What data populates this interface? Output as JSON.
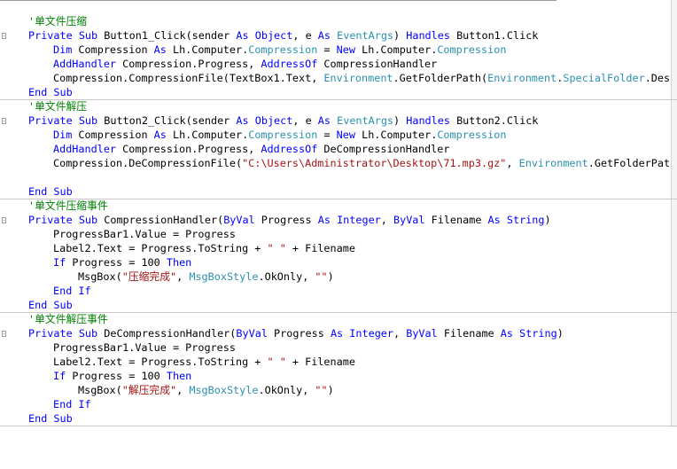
{
  "colors": {
    "keyword": "#0000ff",
    "type": "#2b91af",
    "comment": "#008000",
    "string": "#a31515",
    "plain": "#000000"
  },
  "code": {
    "lines": [
      {
        "indent": 0,
        "tokens": [
          {
            "t": "'单文件压缩",
            "k": "comment"
          }
        ]
      },
      {
        "indent": 0,
        "tokens": [
          {
            "t": "Private Sub",
            "k": "keyword"
          },
          {
            "t": " Button1_Click(sender ",
            "k": "plain"
          },
          {
            "t": "As",
            "k": "keyword"
          },
          {
            "t": " ",
            "k": "plain"
          },
          {
            "t": "Object",
            "k": "keyword"
          },
          {
            "t": ", e ",
            "k": "plain"
          },
          {
            "t": "As",
            "k": "keyword"
          },
          {
            "t": " ",
            "k": "plain"
          },
          {
            "t": "EventArgs",
            "k": "type"
          },
          {
            "t": ") ",
            "k": "plain"
          },
          {
            "t": "Handles",
            "k": "keyword"
          },
          {
            "t": " Button1.Click",
            "k": "plain"
          }
        ]
      },
      {
        "indent": 1,
        "tokens": [
          {
            "t": "Dim",
            "k": "keyword"
          },
          {
            "t": " Compression ",
            "k": "plain"
          },
          {
            "t": "As",
            "k": "keyword"
          },
          {
            "t": " Lh.Computer.",
            "k": "plain"
          },
          {
            "t": "Compression",
            "k": "type"
          },
          {
            "t": " = ",
            "k": "plain"
          },
          {
            "t": "New",
            "k": "keyword"
          },
          {
            "t": " Lh.Computer.",
            "k": "plain"
          },
          {
            "t": "Compression",
            "k": "type"
          }
        ]
      },
      {
        "indent": 1,
        "tokens": [
          {
            "t": "AddHandler",
            "k": "keyword"
          },
          {
            "t": " Compression.Progress, ",
            "k": "plain"
          },
          {
            "t": "AddressOf",
            "k": "keyword"
          },
          {
            "t": " CompressionHandler",
            "k": "plain"
          }
        ]
      },
      {
        "indent": 1,
        "tokens": [
          {
            "t": "Compression.CompressionFile(TextBox1.Text, ",
            "k": "plain"
          },
          {
            "t": "Environment",
            "k": "type"
          },
          {
            "t": ".GetFolderPath(",
            "k": "plain"
          },
          {
            "t": "Environment",
            "k": "type"
          },
          {
            "t": ".",
            "k": "plain"
          },
          {
            "t": "SpecialFolder",
            "k": "type"
          },
          {
            "t": ".Desktop",
            "k": "plain"
          }
        ]
      },
      {
        "indent": 0,
        "tokens": [
          {
            "t": "End Sub",
            "k": "keyword"
          }
        ]
      },
      {
        "indent": 0,
        "tokens": [
          {
            "t": "'单文件解压",
            "k": "comment"
          }
        ]
      },
      {
        "indent": 0,
        "tokens": [
          {
            "t": "Private Sub",
            "k": "keyword"
          },
          {
            "t": " Button2_Click(sender ",
            "k": "plain"
          },
          {
            "t": "As",
            "k": "keyword"
          },
          {
            "t": " ",
            "k": "plain"
          },
          {
            "t": "Object",
            "k": "keyword"
          },
          {
            "t": ", e ",
            "k": "plain"
          },
          {
            "t": "As",
            "k": "keyword"
          },
          {
            "t": " ",
            "k": "plain"
          },
          {
            "t": "EventArgs",
            "k": "type"
          },
          {
            "t": ") ",
            "k": "plain"
          },
          {
            "t": "Handles",
            "k": "keyword"
          },
          {
            "t": " Button2.Click",
            "k": "plain"
          }
        ]
      },
      {
        "indent": 1,
        "tokens": [
          {
            "t": "Dim",
            "k": "keyword"
          },
          {
            "t": " Compression ",
            "k": "plain"
          },
          {
            "t": "As",
            "k": "keyword"
          },
          {
            "t": " Lh.Computer.",
            "k": "plain"
          },
          {
            "t": "Compression",
            "k": "type"
          },
          {
            "t": " = ",
            "k": "plain"
          },
          {
            "t": "New",
            "k": "keyword"
          },
          {
            "t": " Lh.Computer.",
            "k": "plain"
          },
          {
            "t": "Compression",
            "k": "type"
          }
        ]
      },
      {
        "indent": 1,
        "tokens": [
          {
            "t": "AddHandler",
            "k": "keyword"
          },
          {
            "t": " Compression.Progress, ",
            "k": "plain"
          },
          {
            "t": "AddressOf",
            "k": "keyword"
          },
          {
            "t": " DeCompressionHandler",
            "k": "plain"
          }
        ]
      },
      {
        "indent": 1,
        "tokens": [
          {
            "t": "Compression.DeCompressionFile(",
            "k": "plain"
          },
          {
            "t": "\"C:\\Users\\Administrator\\Desktop\\71.mp3.gz\"",
            "k": "string"
          },
          {
            "t": ", ",
            "k": "plain"
          },
          {
            "t": "Environment",
            "k": "type"
          },
          {
            "t": ".GetFolderPath(E",
            "k": "plain"
          }
        ]
      },
      {
        "indent": 0,
        "tokens": []
      },
      {
        "indent": 0,
        "tokens": [
          {
            "t": "End Sub",
            "k": "keyword"
          }
        ]
      },
      {
        "indent": 0,
        "tokens": [
          {
            "t": "'单文件压缩事件",
            "k": "comment"
          }
        ]
      },
      {
        "indent": 0,
        "tokens": [
          {
            "t": "Private Sub",
            "k": "keyword"
          },
          {
            "t": " CompressionHandler(",
            "k": "plain"
          },
          {
            "t": "ByVal",
            "k": "keyword"
          },
          {
            "t": " Progress ",
            "k": "plain"
          },
          {
            "t": "As",
            "k": "keyword"
          },
          {
            "t": " ",
            "k": "plain"
          },
          {
            "t": "Integer",
            "k": "keyword"
          },
          {
            "t": ", ",
            "k": "plain"
          },
          {
            "t": "ByVal",
            "k": "keyword"
          },
          {
            "t": " Filename ",
            "k": "plain"
          },
          {
            "t": "As",
            "k": "keyword"
          },
          {
            "t": " ",
            "k": "plain"
          },
          {
            "t": "String",
            "k": "keyword"
          },
          {
            "t": ")",
            "k": "plain"
          }
        ]
      },
      {
        "indent": 1,
        "tokens": [
          {
            "t": "ProgressBar1.Value = Progress",
            "k": "plain"
          }
        ]
      },
      {
        "indent": 1,
        "tokens": [
          {
            "t": "Label2.Text = Progress.ToString + ",
            "k": "plain"
          },
          {
            "t": "\" \"",
            "k": "string"
          },
          {
            "t": " + Filename",
            "k": "plain"
          }
        ]
      },
      {
        "indent": 1,
        "tokens": [
          {
            "t": "If",
            "k": "keyword"
          },
          {
            "t": " Progress = 100 ",
            "k": "plain"
          },
          {
            "t": "Then",
            "k": "keyword"
          }
        ]
      },
      {
        "indent": 2,
        "tokens": [
          {
            "t": "MsgBox(",
            "k": "plain"
          },
          {
            "t": "\"压缩完成\"",
            "k": "string"
          },
          {
            "t": ", ",
            "k": "plain"
          },
          {
            "t": "MsgBoxStyle",
            "k": "type"
          },
          {
            "t": ".OkOnly, ",
            "k": "plain"
          },
          {
            "t": "\"\"",
            "k": "string"
          },
          {
            "t": ")",
            "k": "plain"
          }
        ]
      },
      {
        "indent": 1,
        "tokens": [
          {
            "t": "End If",
            "k": "keyword"
          }
        ]
      },
      {
        "indent": 0,
        "tokens": [
          {
            "t": "End Sub",
            "k": "keyword"
          }
        ]
      },
      {
        "indent": 0,
        "tokens": [
          {
            "t": "'单文件解压事件",
            "k": "comment"
          }
        ]
      },
      {
        "indent": 0,
        "tokens": [
          {
            "t": "Private Sub",
            "k": "keyword"
          },
          {
            "t": " DeCompressionHandler(",
            "k": "plain"
          },
          {
            "t": "ByVal",
            "k": "keyword"
          },
          {
            "t": " Progress ",
            "k": "plain"
          },
          {
            "t": "As",
            "k": "keyword"
          },
          {
            "t": " ",
            "k": "plain"
          },
          {
            "t": "Integer",
            "k": "keyword"
          },
          {
            "t": ", ",
            "k": "plain"
          },
          {
            "t": "ByVal",
            "k": "keyword"
          },
          {
            "t": " Filename ",
            "k": "plain"
          },
          {
            "t": "As",
            "k": "keyword"
          },
          {
            "t": " ",
            "k": "plain"
          },
          {
            "t": "String",
            "k": "keyword"
          },
          {
            "t": ")",
            "k": "plain"
          }
        ]
      },
      {
        "indent": 1,
        "tokens": [
          {
            "t": "ProgressBar1.Value = Progress",
            "k": "plain"
          }
        ]
      },
      {
        "indent": 1,
        "tokens": [
          {
            "t": "Label2.Text = Progress.ToString + ",
            "k": "plain"
          },
          {
            "t": "\" \"",
            "k": "string"
          },
          {
            "t": " + Filename",
            "k": "plain"
          }
        ]
      },
      {
        "indent": 1,
        "tokens": [
          {
            "t": "If",
            "k": "keyword"
          },
          {
            "t": " Progress = 100 ",
            "k": "plain"
          },
          {
            "t": "Then",
            "k": "keyword"
          }
        ]
      },
      {
        "indent": 2,
        "tokens": [
          {
            "t": "MsgBox(",
            "k": "plain"
          },
          {
            "t": "\"解压完成\"",
            "k": "string"
          },
          {
            "t": ", ",
            "k": "plain"
          },
          {
            "t": "MsgBoxStyle",
            "k": "type"
          },
          {
            "t": ".OkOnly, ",
            "k": "plain"
          },
          {
            "t": "\"\"",
            "k": "string"
          },
          {
            "t": ")",
            "k": "plain"
          }
        ]
      },
      {
        "indent": 1,
        "tokens": [
          {
            "t": "End If",
            "k": "keyword"
          }
        ]
      },
      {
        "indent": 0,
        "tokens": [
          {
            "t": "End Sub",
            "k": "keyword"
          }
        ]
      }
    ]
  }
}
